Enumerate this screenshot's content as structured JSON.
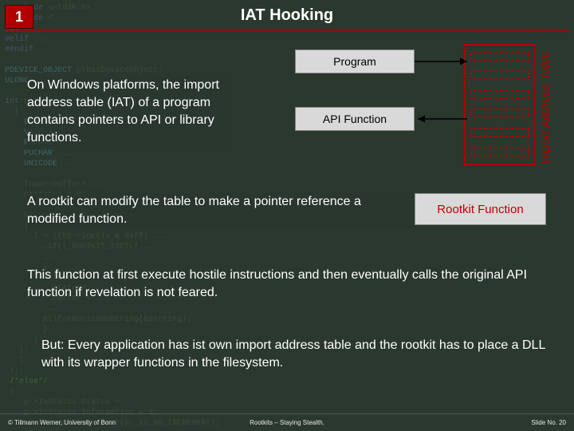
{
  "chapter": "1",
  "title": "IAT Hooking",
  "paragraphs": {
    "p1": "On Windows platforms, the import address table (IAT) of a program contains pointers to API or library functions.",
    "p2": "A rootkit can modify the table to make a pointer reference a modified function.",
    "p3": "This function at first execute hostile instructions and then eventually calls the original API function if revelation is not feared.",
    "p4": "But: Every application has ist own import address table and the rootkit has to place a DLL with its wrapper functions in the filesystem."
  },
  "diagram": {
    "program": "Program",
    "api": "API Function",
    "rootkit": "Rootkit Function",
    "iat_label": "Import Address Table"
  },
  "footer": {
    "left": "© Tillmann Werner, University of Bonn",
    "center": "Rootkits – Staying Stealth.",
    "right": "Slide No. 20"
  }
}
